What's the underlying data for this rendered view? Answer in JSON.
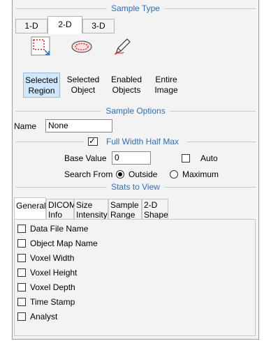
{
  "sample_type": {
    "title": "Sample Type",
    "tabs": [
      "1-D",
      "2-D",
      "3-D"
    ],
    "active_tab": "2-D",
    "tools": [
      {
        "line1": "Selected",
        "line2": "Region",
        "icon": "selected-region-icon",
        "selected": true
      },
      {
        "line1": "Selected",
        "line2": "Object",
        "icon": "selected-object-icon",
        "selected": false
      },
      {
        "line1": "Enabled",
        "line2": "Objects",
        "icon": "enabled-objects-icon",
        "selected": false
      },
      {
        "line1": "Entire",
        "line2": "Image",
        "icon": "entire-image-icon",
        "selected": false
      }
    ]
  },
  "sample_options": {
    "title": "Sample Options",
    "name_label": "Name",
    "name_value": "None",
    "fwhm_label": "Full Width Half Max",
    "fwhm_checked": true,
    "base_value_label": "Base Value",
    "base_value": "0",
    "auto_label": "Auto",
    "auto_checked": false,
    "search_from_label": "Search From",
    "outside_label": "Outside",
    "maximum_label": "Maximum",
    "search_from_selected": "Outside"
  },
  "stats": {
    "title": "Stats to View",
    "tabs": [
      {
        "line1": "General",
        "line2": ""
      },
      {
        "line1": "DICOM",
        "line2": "Info"
      },
      {
        "line1": "Size",
        "line2": "Intensity"
      },
      {
        "line1": "Sample",
        "line2": "Range"
      },
      {
        "line1": "2-D",
        "line2": "Shape"
      }
    ],
    "active_tab": "General",
    "items": [
      {
        "label": "Data File Name",
        "checked": false
      },
      {
        "label": "Object Map Name",
        "checked": false
      },
      {
        "label": "Voxel Width",
        "checked": false
      },
      {
        "label": "Voxel Height",
        "checked": false
      },
      {
        "label": "Voxel Depth",
        "checked": false
      },
      {
        "label": "Time Stamp",
        "checked": false
      },
      {
        "label": "Analyst",
        "checked": false
      }
    ]
  },
  "colors": {
    "section_title": "#2f6fb5",
    "selected_tool_bg": "#cfe6fb",
    "panel_bg": "#f3f3f3"
  }
}
